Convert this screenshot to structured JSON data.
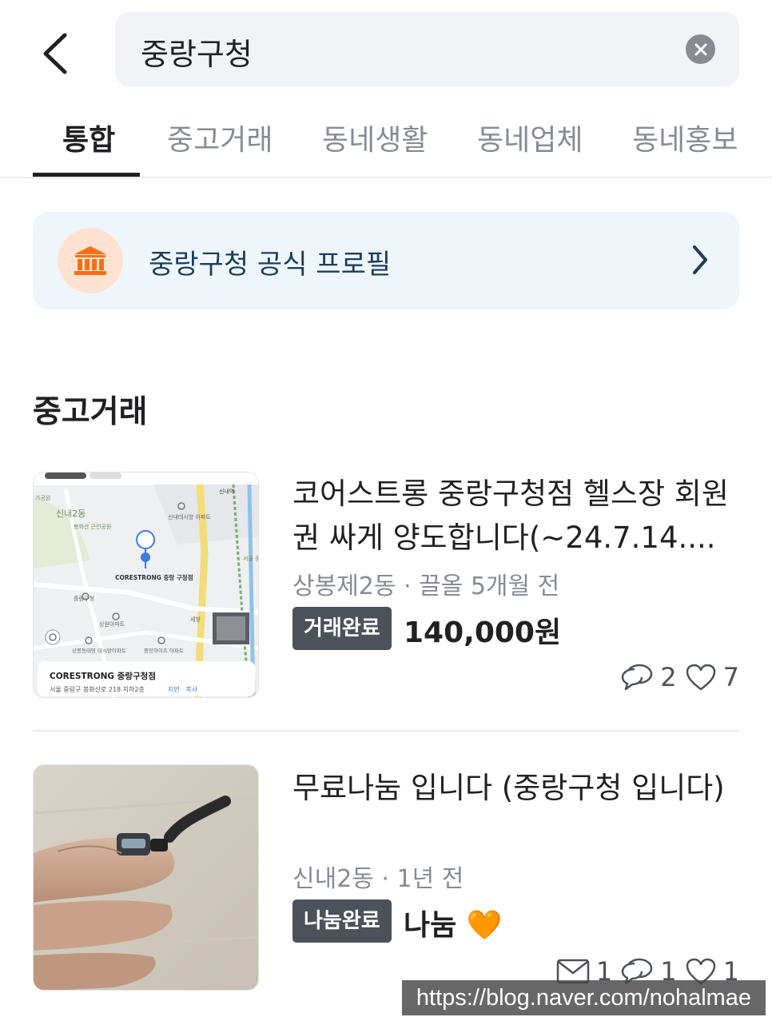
{
  "search": {
    "query": "중랑구청"
  },
  "tabs": [
    {
      "label": "통합",
      "active": true
    },
    {
      "label": "중고거래",
      "active": false
    },
    {
      "label": "동네생활",
      "active": false
    },
    {
      "label": "동네업체",
      "active": false
    },
    {
      "label": "동네홍보",
      "active": false
    }
  ],
  "official_profile": {
    "label": "중랑구청 공식 프로필",
    "icon": "government-building-icon"
  },
  "section": {
    "title": "중고거래"
  },
  "items": [
    {
      "title": "코어스트롱 중랑구청점 헬스장 회원권 싸게 양도합니다(~24.7.14....",
      "meta": "상봉제2동 · 끌올 5개월 전",
      "status": "거래완료",
      "price": "140,000원",
      "chats": "2",
      "likes": "7",
      "thumbnail": {
        "type": "map",
        "place_name": "CORESTRONG 중랑구청점",
        "address": "서울 중랑구 봉화산로 218 지하2층",
        "address_links": "지번 · 복사",
        "labels": [
          "신내2동",
          "봉화산 근린공원",
          "신내데시앙 아파트",
          "CORESTRONG 중랑 구청점",
          "중랑구청",
          "상원아파트",
          "상봉동태영 데시앙아파트",
          "중앙하이츠 아파트",
          "세창",
          "서울 중랑",
          "신내역",
          "가공원"
        ]
      }
    },
    {
      "title": "무료나눔 입니다 (중랑구청 입니다)",
      "meta": "신내2동 · 1년 전",
      "status": "나눔완료",
      "price": "나눔",
      "price_emoji": "🧡",
      "messages": "1",
      "chats": "1",
      "likes": "1",
      "thumbnail": {
        "type": "photo",
        "subject": "hand holding usb cable"
      }
    }
  ],
  "watermark": "https://blog.naver.com/nohalmae",
  "colors": {
    "badge": "#4d5159",
    "accent": "#ff6f0f",
    "profile_bg": "#eef6fb",
    "muted": "#868b94"
  }
}
